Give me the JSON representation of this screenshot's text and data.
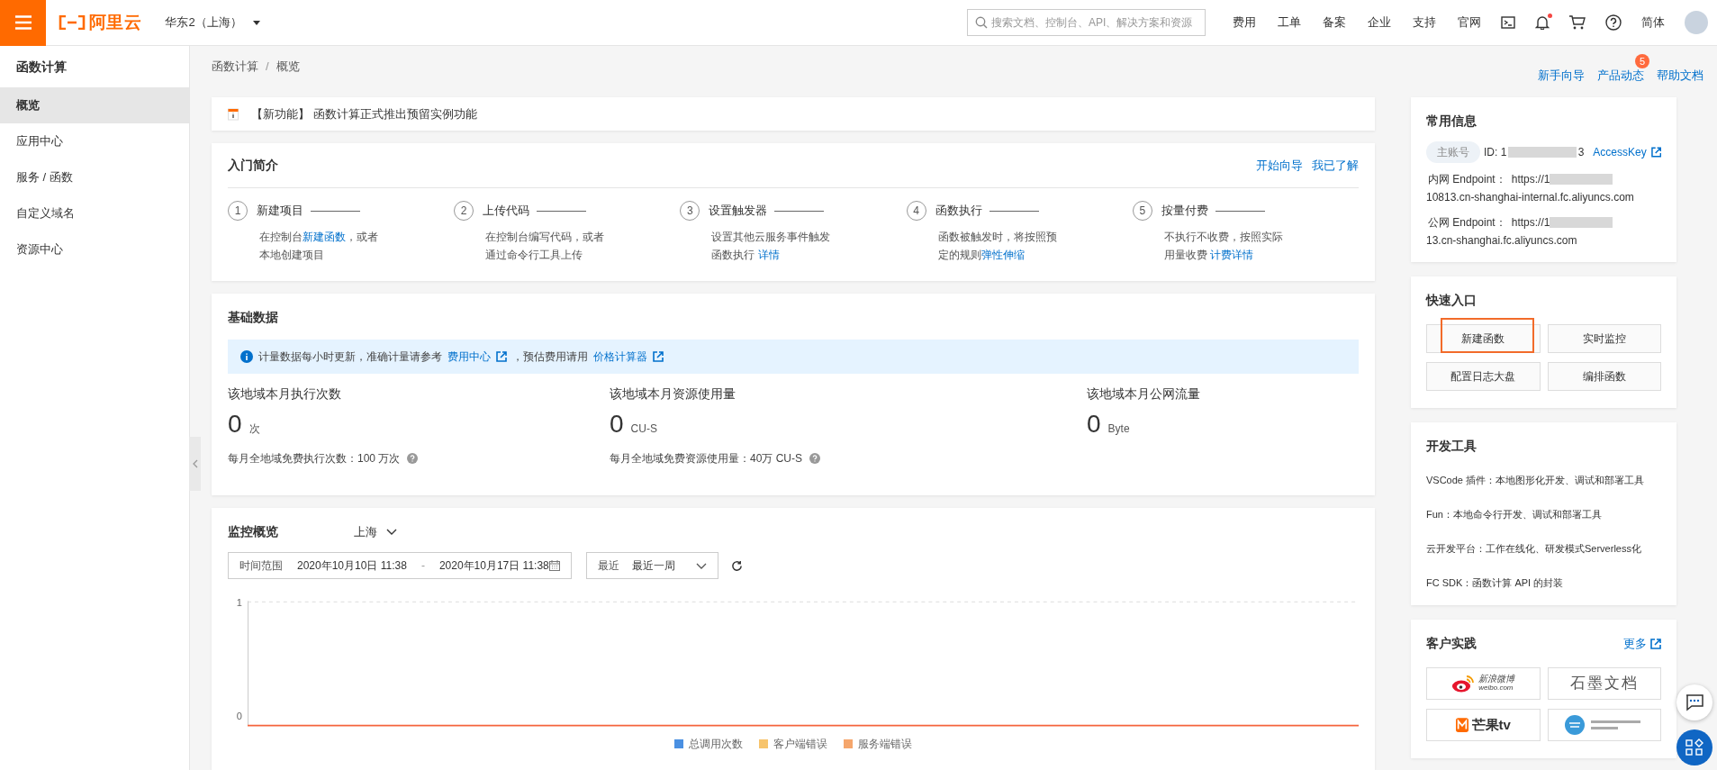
{
  "topbar": {
    "logo_text": "阿里云",
    "region": "华东2（上海）",
    "search": {
      "placeholder": "搜索文档、控制台、API、解决方案和资源"
    },
    "nav": [
      "费用",
      "工单",
      "备案",
      "企业",
      "支持",
      "官网"
    ],
    "bell_unread": true,
    "language": "简体"
  },
  "sidebar": {
    "title": "函数计算",
    "items": [
      {
        "label": "概览",
        "selected": true
      },
      {
        "label": "应用中心",
        "selected": false
      },
      {
        "label": "服务 / 函数",
        "selected": false
      },
      {
        "label": "自定义域名",
        "selected": false
      },
      {
        "label": "资源中心",
        "selected": false
      }
    ]
  },
  "breadcrumb": {
    "items": [
      "函数计算",
      "概览"
    ],
    "separator": "/"
  },
  "header_links": [
    {
      "label": "新手向导"
    },
    {
      "label": "产品动态",
      "badge": "5"
    },
    {
      "label": "帮助文档"
    }
  ],
  "notice": {
    "text": "【新功能】 函数计算正式推出预留实例功能"
  },
  "intro": {
    "title": "入门简介",
    "actions": [
      "开始向导",
      "我已了解"
    ],
    "steps": [
      {
        "number": "1",
        "title": "新建项目",
        "before": "在控制台",
        "link": "新建函数",
        "after": "，或者本地创建项目"
      },
      {
        "number": "2",
        "title": "上传代码",
        "before": "在控制台编写代码，或者通过命令行工具上传"
      },
      {
        "number": "3",
        "title": "设置触发器",
        "before": "设置其他云服务事件触发函数执行 ",
        "link": "详情"
      },
      {
        "number": "4",
        "title": "函数执行",
        "before": "函数被触发时，将按照预定的规则",
        "link": "弹性伸缩"
      },
      {
        "number": "5",
        "title": "按量付费",
        "before": "不执行不收费，按照实际用量收费 ",
        "link": "计费详情"
      }
    ]
  },
  "basic_data": {
    "title": "基础数据",
    "info": {
      "text1": "计量数据每小时更新，准确计量请参考",
      "link1": "费用中心",
      "text2": "，预估费用请用",
      "link2": "价格计算器"
    },
    "metrics": [
      {
        "label": "该地域本月执行次数",
        "value": "0",
        "unit": "次",
        "note": "每月全地域免费执行次数：100 万次"
      },
      {
        "label": "该地域本月资源使用量",
        "value": "0",
        "unit": "CU-S",
        "note": "每月全地域免费资源使用量：40万 CU-S"
      },
      {
        "label": "该地域本月公网流量",
        "value": "0",
        "unit": "Byte"
      }
    ]
  },
  "monitor": {
    "title": "监控概览",
    "region": "上海",
    "time_range": {
      "label": "时间范围",
      "start": "2020年10月10日 11:38",
      "separator": "-",
      "end": "2020年10月17日 11:38"
    },
    "recent": {
      "label": "最近",
      "value": "最近一周"
    },
    "chart": {
      "y_axis_labels": [
        "1",
        "0"
      ],
      "legend": [
        {
          "name": "总调用次数",
          "color": "#4a90e2"
        },
        {
          "name": "客户端错误",
          "color": "#f7c46c"
        },
        {
          "name": "服务端错误",
          "color": "#f5a66c"
        }
      ]
    }
  },
  "common_info": {
    "title": "常用信息",
    "account_tag": "主账号",
    "id_prefix": "ID: 1",
    "id_suffix": "3",
    "access_key": "AccessKey",
    "endpoints": [
      {
        "label": "内网 Endpoint：",
        "prefix": "https://1",
        "suffix": "10813.cn-shanghai-internal.fc.aliyuncs.com"
      },
      {
        "label": "公网 Endpoint：",
        "prefix": "https://1",
        "suffix": "13.cn-shanghai.fc.aliyuncs.com"
      }
    ]
  },
  "quick_entry": {
    "title": "快速入口",
    "buttons": [
      {
        "label": "新建函数",
        "highlighted": true
      },
      {
        "label": "实时监控",
        "highlighted": false
      },
      {
        "label": "配置日志大盘",
        "highlighted": false
      },
      {
        "label": "编排函数",
        "highlighted": false
      }
    ]
  },
  "dev_tools": {
    "title": "开发工具",
    "items": [
      "VSCode 插件：本地图形化开发、调试和部署工具",
      "Fun：本地命令行开发、调试和部署工具",
      "云开发平台：工作在线化、研发模式Serverless化",
      "FC SDK：函数计算 API 的封装"
    ]
  },
  "customers": {
    "title": "客户实践",
    "more": "更多",
    "logos": [
      {
        "kind": "weibo",
        "text": "新浪微博",
        "subtext": "weibo.com"
      },
      {
        "kind": "shimo",
        "text": "石墨文档"
      },
      {
        "kind": "mango",
        "text": "芒果tv"
      },
      {
        "kind": "institute"
      }
    ]
  }
}
